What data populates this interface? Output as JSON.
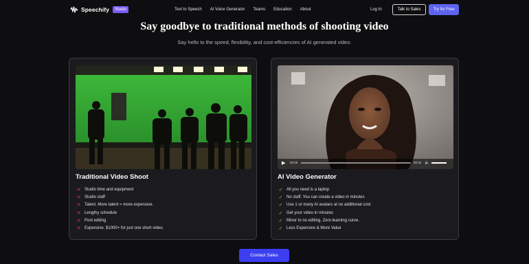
{
  "nav": {
    "brand": "Speechify",
    "badge": "Studio",
    "links": [
      "Text to Speech",
      "AI Voice Generator",
      "Teams",
      "Education",
      "About"
    ],
    "login": "Log In",
    "talk_label": "Talk to Sales",
    "try_label": "Try for Free"
  },
  "hero": {
    "title": "Say goodbye to traditional methods of shooting video",
    "subtitle": "Say hello to the speed, flexibility, and cost-efficiencies of AI generated video."
  },
  "cards": [
    {
      "title": "Traditional Video Shoot",
      "icon": "x-icon",
      "items": [
        "Studio time and equipment",
        "Studio staff",
        "Talent. More talent = more expensive.",
        "Lengthy schedule",
        "Post editing",
        "Expensive. $1000+ for just one short video."
      ]
    },
    {
      "title": "AI Video Generator",
      "icon": "check-icon",
      "items": [
        "All you need is a laptop",
        "No staff. You can create a video in minutes",
        "Use 1 or many AI avatars at no additional cost",
        "Get your video in minutes",
        "Minor to no editing. Zero learning curve.",
        "Less Expensive & More Value"
      ],
      "player": {
        "current_time": "00:05",
        "duration": "00:32",
        "progress": 0.0
      }
    }
  ],
  "cta_label": "Contact Sales",
  "colors": {
    "background": "#0e0e10",
    "accent": "#5e63f0",
    "badge": "#7b5cf5",
    "cross": "#e23b3b",
    "check": "#e7a23a"
  }
}
